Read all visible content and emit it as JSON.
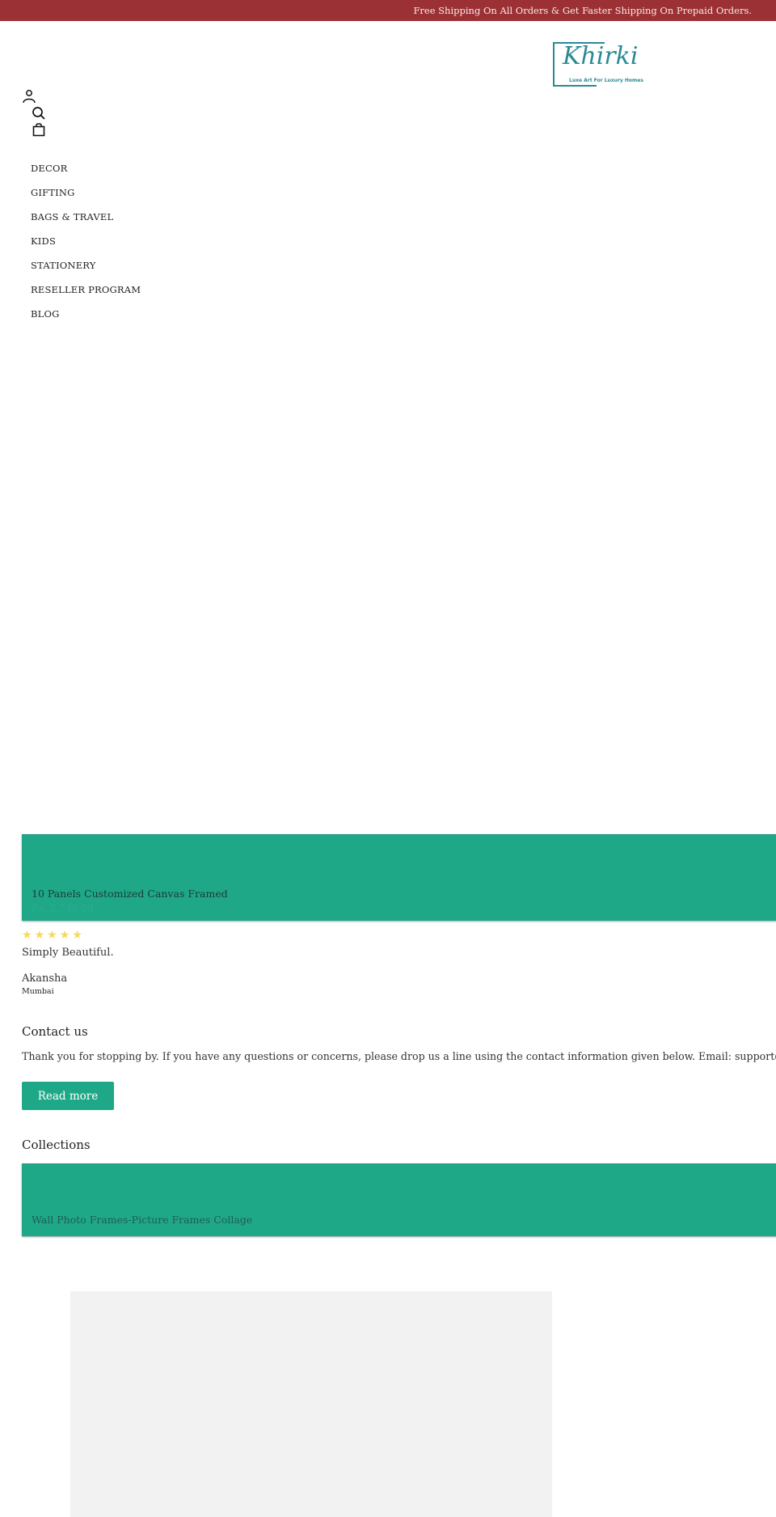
{
  "announcement": {
    "text": "Free Shipping On All Orders & Get Faster Shipping On Prepaid Orders.",
    "background": "#9c3135"
  },
  "logo": {
    "name": "Khirki",
    "tagline": "Luxe Art For Luxury Homes",
    "color": "#2a8a94"
  },
  "header_icons": [
    {
      "name": "account-icon"
    },
    {
      "name": "search-icon"
    },
    {
      "name": "cart-bag-icon"
    }
  ],
  "nav": {
    "items": [
      {
        "label": "DECOR"
      },
      {
        "label": "GIFTING"
      },
      {
        "label": "BAGS & TRAVEL"
      },
      {
        "label": "KIDS"
      },
      {
        "label": "STATIONERY"
      },
      {
        "label": "RESELLER PROGRAM"
      },
      {
        "label": "BLOG"
      }
    ]
  },
  "featured_product": {
    "title": "10 Panels Customized Canvas Framed",
    "price": "Rs. 2,745.00",
    "background": "#1fa888"
  },
  "testimonial": {
    "rating": 5,
    "rating_max": 5,
    "star_glyph": "★",
    "text": "Simply Beautiful.",
    "author": "Akansha",
    "location": "Mumbai"
  },
  "contact": {
    "title": "Contact us",
    "body": "Thank you for stopping by. If you have any questions or concerns, please drop us a line using the contact information given below. Email: support@",
    "button_label": "Read more"
  },
  "collections": {
    "title": "Collections",
    "items": [
      {
        "title": "Wall Photo Frames-Picture Frames Collage"
      }
    ]
  }
}
